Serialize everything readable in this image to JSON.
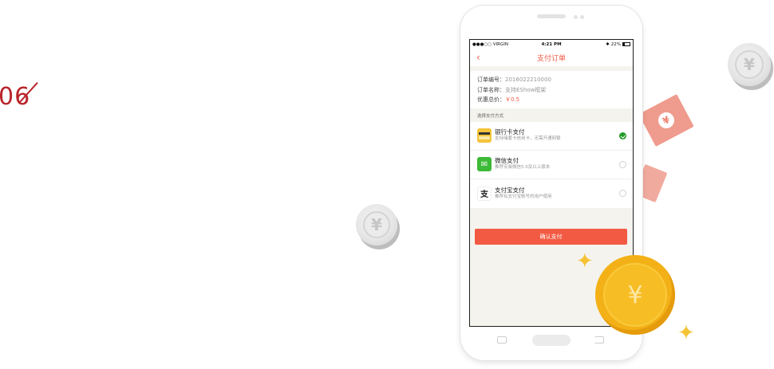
{
  "section": {
    "number": "06"
  },
  "status_bar": {
    "carrier": "●●●○○ VIRGIN",
    "time": "4:21 PM",
    "battery": "22%"
  },
  "nav": {
    "back_icon": "‹",
    "title": "支付订单"
  },
  "order": {
    "number_label": "订单编号：",
    "number_value": "2016022210000",
    "name_label": "订单名称：",
    "name_value": "支持EShow框架",
    "total_label": "优惠总价：",
    "total_value": "￥0.5"
  },
  "payment": {
    "section_label": "选择支付方式",
    "methods": [
      {
        "name": "银行卡支付",
        "desc": "支持储蓄卡信用卡，无需开通网银",
        "selected": true
      },
      {
        "name": "微信支付",
        "desc": "推荐安装微信5.0及以上版本",
        "selected": false
      },
      {
        "name": "支付宝支付",
        "desc": "推荐有支付宝账号的用户使用",
        "selected": false
      }
    ]
  },
  "confirm_button": "确认支付",
  "icons": {
    "bank": "bank-card-icon",
    "wechat": "wechat-icon",
    "alipay": "alipay-icon",
    "alipay_glyph": "支",
    "wechat_glyph": "✉",
    "coin_glyph": "¥"
  },
  "colors": {
    "accent": "#ef5a44",
    "check": "#239a2a",
    "section_number": "#b8252b",
    "gold": "#f3b117"
  }
}
